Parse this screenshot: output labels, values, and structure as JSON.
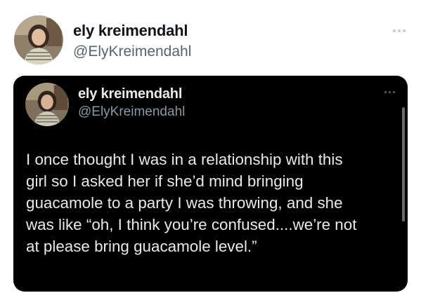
{
  "outer_tweet": {
    "display_name": "ely kreimendahl",
    "handle": "@ElyKreimendahl",
    "more_icon": "ellipsis-icon"
  },
  "quoted_tweet": {
    "display_name": "ely kreimendahl",
    "handle": "@ElyKreimendahl",
    "more_icon": "ellipsis-icon",
    "text_lines": [
      "I once thought I was in a relationship with this",
      "girl so I asked her if she’d mind bringing",
      "guacamole to a party I was throwing, and she",
      "was like “oh, I think you’re confused....we’re not",
      "at please bring guacamole level.”"
    ]
  },
  "colors": {
    "page_bg": "#ffffff",
    "card_bg": "#000000",
    "name_dark": "#0f1419",
    "handle_gray": "#536471",
    "text_light": "#e7e9ea"
  }
}
